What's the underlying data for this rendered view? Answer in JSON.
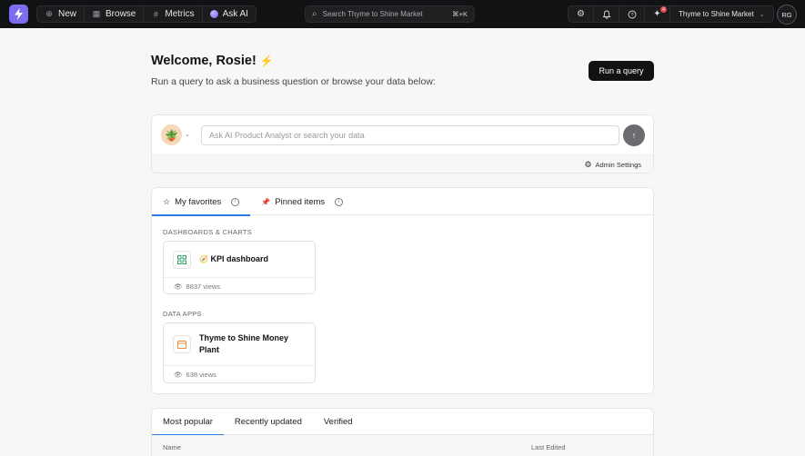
{
  "topbar": {
    "nav": [
      {
        "label": "New",
        "icon": "plus-circle-icon"
      },
      {
        "label": "Browse",
        "icon": "grid-icon"
      },
      {
        "label": "Metrics",
        "icon": "hash-icon"
      },
      {
        "label": "Ask AI",
        "icon": "ai-orb-icon"
      }
    ],
    "search_placeholder": "Search Thyme to Shine Market",
    "search_shortcut": "⌘+K",
    "notification_count": "4",
    "workspace": "Thyme to Shine Market",
    "user_initials": "RG"
  },
  "welcome": {
    "title": "Welcome, Rosie!",
    "title_emoji": "⚡",
    "subtitle": "Run a query to ask a business question or browse your data below:",
    "run_query_label": "Run a query"
  },
  "ask": {
    "placeholder": "Ask AI Product Analyst or search your data",
    "admin_settings_label": "Admin Settings"
  },
  "favorites": {
    "tabs": [
      {
        "label": "My favorites",
        "active": true
      },
      {
        "label": "Pinned items",
        "active": false
      }
    ],
    "sections": [
      {
        "heading": "DASHBOARDS & CHARTS",
        "items": [
          {
            "emoji": "🧭",
            "name": "KPI dashboard",
            "views": "8837 views"
          }
        ]
      },
      {
        "heading": "DATA APPS",
        "items": [
          {
            "name_line1": "Thyme to Shine Money",
            "name_line2": "Plant",
            "views": "638 views"
          }
        ]
      }
    ]
  },
  "popular": {
    "tabs": [
      {
        "label": "Most popular",
        "active": true
      },
      {
        "label": "Recently updated",
        "active": false
      },
      {
        "label": "Verified",
        "active": false
      }
    ],
    "columns": [
      "Name",
      "Last Edited"
    ]
  },
  "colors": {
    "accent": "#2c7be5",
    "logo": "#7b6cf0",
    "topbar": "#111213"
  }
}
